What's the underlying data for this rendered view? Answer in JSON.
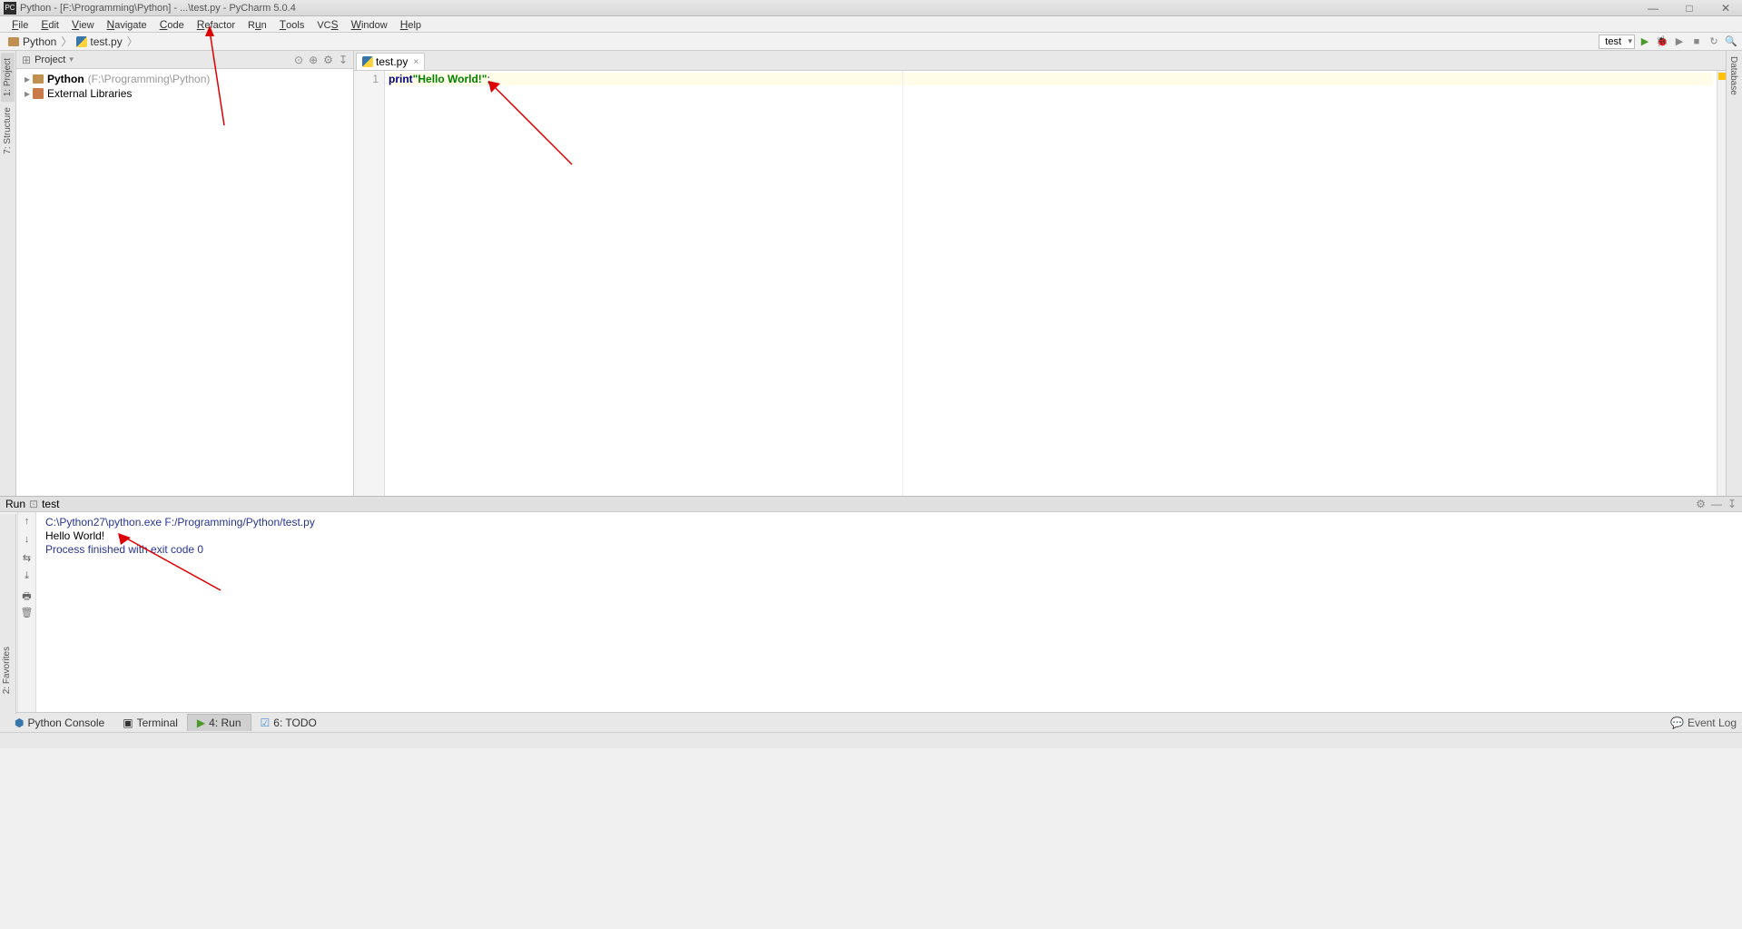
{
  "window": {
    "title": "Python - [F:\\Programming\\Python] - ...\\test.py - PyCharm 5.0.4"
  },
  "menu": {
    "items": [
      "File",
      "Edit",
      "View",
      "Navigate",
      "Code",
      "Refactor",
      "Run",
      "Tools",
      "VCS",
      "Window",
      "Help"
    ]
  },
  "breadcrumb": {
    "project": "Python",
    "file": "test.py"
  },
  "toolbar": {
    "run_config": "test"
  },
  "left_tabs": {
    "project": "1: Project",
    "structure": "7: Structure"
  },
  "right_tabs": {
    "database": "Database"
  },
  "project_panel": {
    "title": "Project",
    "root_name": "Python",
    "root_hint": "(F:\\Programming\\Python)",
    "external_libs": "External Libraries"
  },
  "editor": {
    "tab_name": "test.py",
    "line_number": "1",
    "code_keyword": "print",
    "code_string": "\"Hello World!\"",
    "code_semicolon": ";"
  },
  "run_panel": {
    "title_prefix": "Run",
    "title_name": "test",
    "line1": "C:\\Python27\\python.exe F:/Programming/Python/test.py",
    "line2": "Hello World!",
    "line3": "",
    "line4": "Process finished with exit code 0"
  },
  "bottom_tabs": {
    "python_console": "Python Console",
    "terminal": "Terminal",
    "run": "4: Run",
    "todo": "6: TODO",
    "event_log": "Event Log"
  },
  "left_favorites": "2: Favorites"
}
